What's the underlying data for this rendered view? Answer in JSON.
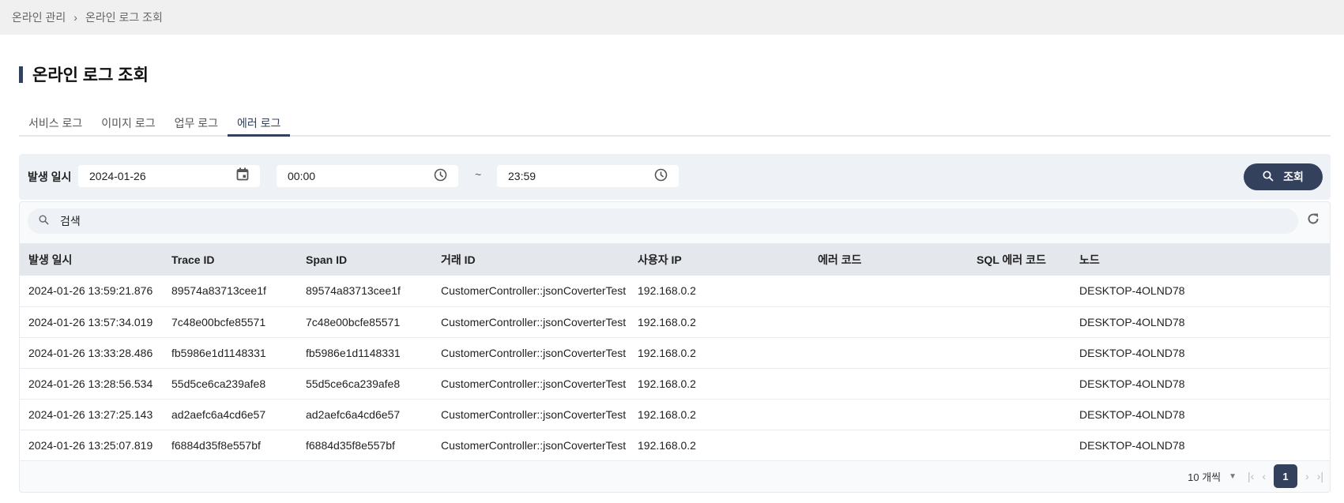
{
  "breadcrumb": {
    "items": [
      "온라인 관리",
      "온라인 로그 조회"
    ],
    "separator": "›"
  },
  "page_title": "온라인 로그 조회",
  "tabs": [
    {
      "label": "서비스 로그",
      "active": false
    },
    {
      "label": "이미지 로그",
      "active": false
    },
    {
      "label": "업무 로그",
      "active": false
    },
    {
      "label": "에러 로그",
      "active": true
    }
  ],
  "filter": {
    "label": "발생 일시",
    "date": "2024-01-26",
    "time_from": "00:00",
    "separator": "~",
    "time_to": "23:59",
    "search_button": "조회"
  },
  "search": {
    "placeholder": "검색"
  },
  "table": {
    "columns": [
      "발생 일시",
      "Trace ID",
      "Span ID",
      "거래 ID",
      "사용자 IP",
      "에러 코드",
      "SQL 에러 코드",
      "노드"
    ],
    "rows": [
      [
        "2024-01-26 13:59:21.876",
        "89574a83713cee1f",
        "89574a83713cee1f",
        "CustomerController::jsonCoverterTest",
        "192.168.0.2",
        "",
        "",
        "DESKTOP-4OLND78"
      ],
      [
        "2024-01-26 13:57:34.019",
        "7c48e00bcfe85571",
        "7c48e00bcfe85571",
        "CustomerController::jsonCoverterTest",
        "192.168.0.2",
        "",
        "",
        "DESKTOP-4OLND78"
      ],
      [
        "2024-01-26 13:33:28.486",
        "fb5986e1d1148331",
        "fb5986e1d1148331",
        "CustomerController::jsonCoverterTest",
        "192.168.0.2",
        "",
        "",
        "DESKTOP-4OLND78"
      ],
      [
        "2024-01-26 13:28:56.534",
        "55d5ce6ca239afe8",
        "55d5ce6ca239afe8",
        "CustomerController::jsonCoverterTest",
        "192.168.0.2",
        "",
        "",
        "DESKTOP-4OLND78"
      ],
      [
        "2024-01-26 13:27:25.143",
        "ad2aefc6a4cd6e57",
        "ad2aefc6a4cd6e57",
        "CustomerController::jsonCoverterTest",
        "192.168.0.2",
        "",
        "",
        "DESKTOP-4OLND78"
      ],
      [
        "2024-01-26 13:25:07.819",
        "f6884d35f8e557bf",
        "f6884d35f8e557bf",
        "CustomerController::jsonCoverterTest",
        "192.168.0.2",
        "",
        "",
        "DESKTOP-4OLND78"
      ]
    ]
  },
  "pagination": {
    "page_size": "10 개씩",
    "current_page": "1"
  },
  "colors": {
    "accent": "#33415c",
    "panel": "#eef2f7"
  }
}
